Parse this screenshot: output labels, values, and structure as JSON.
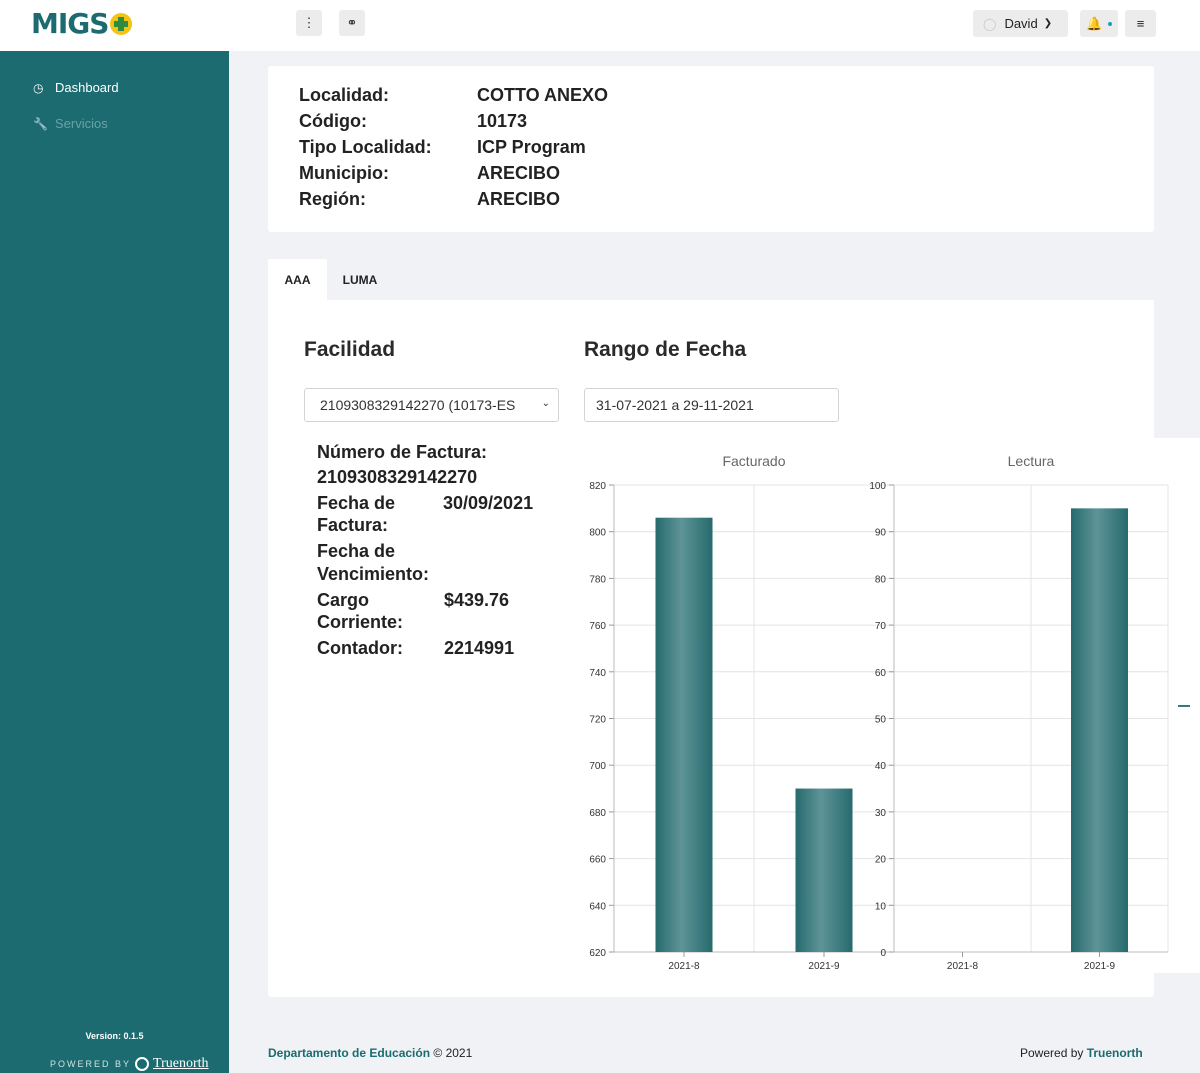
{
  "header": {
    "logo_text": "MIGS",
    "user_name": "David"
  },
  "sidebar": {
    "items": [
      {
        "label": "Dashboard",
        "icon": "gauge-icon"
      },
      {
        "label": "Servicios",
        "icon": "wrench-icon"
      }
    ],
    "version": "Version: 0.1.5",
    "powered_by": "POWERED BY",
    "brand": "Truenorth"
  },
  "info": {
    "rows": [
      {
        "label": "Localidad:",
        "value": "COTTO ANEXO"
      },
      {
        "label": "Código:",
        "value": "10173"
      },
      {
        "label": "Tipo Localidad:",
        "value": "ICP Program"
      },
      {
        "label": "Municipio:",
        "value": "ARECIBO"
      },
      {
        "label": "Región:",
        "value": "ARECIBO"
      }
    ]
  },
  "tabs": [
    {
      "label": "AAA",
      "active": true
    },
    {
      "label": "LUMA",
      "active": false
    }
  ],
  "facilidad": {
    "heading": "Facilidad",
    "selected": "2109308329142270 (10173-ES"
  },
  "rango": {
    "heading": "Rango de Fecha",
    "value": "31-07-2021 a 29-11-2021"
  },
  "factura": {
    "numero_label": "Número de Factura:",
    "numero_value": "2109308329142270",
    "fecha_label_1": "Fecha de",
    "fecha_label_2": "Factura:",
    "fecha_value": "30/09/2021",
    "venc_label_1": "Fecha de",
    "venc_label_2": "Vencimiento:",
    "cargo_label_1": "Cargo",
    "cargo_label_2": "Corriente:",
    "cargo_value": "$439.76",
    "contador_label": "Contador:",
    "contador_value": "2214991"
  },
  "chart_data": [
    {
      "type": "bar",
      "title": "Facturado",
      "categories": [
        "2021-8",
        "2021-9"
      ],
      "values": [
        806,
        690
      ],
      "ylim": [
        620,
        820
      ],
      "yticks": [
        620,
        640,
        660,
        680,
        700,
        720,
        740,
        760,
        780,
        800,
        820
      ],
      "grid": true,
      "color": "#2c6e72"
    },
    {
      "type": "bar",
      "title": "Lectura",
      "categories": [
        "2021-8",
        "2021-9"
      ],
      "values": [
        0,
        95
      ],
      "ylim": [
        0,
        100
      ],
      "yticks": [
        0,
        10,
        20,
        30,
        40,
        50,
        60,
        70,
        80,
        90,
        100
      ],
      "grid": true,
      "color": "#2c6e72"
    }
  ],
  "footer": {
    "dept": "Departamento de Educación",
    "copyright": "© 2021",
    "powered": "Powered by",
    "brand": "Truenorth"
  }
}
